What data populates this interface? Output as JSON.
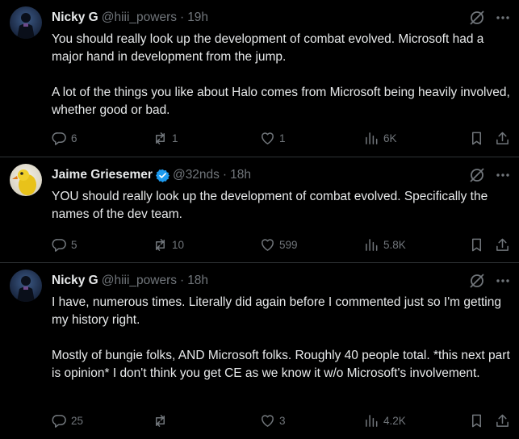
{
  "tweets": [
    {
      "author": {
        "name": "Nicky G",
        "handle": "@hiii_powers",
        "verified": false
      },
      "time": "19h",
      "paragraphs": [
        "You should really look up the development of combat evolved. Microsoft had a major hand in development from the jump.",
        "A lot of the things you like about Halo comes from Microsoft being heavily involved, whether good or bad."
      ],
      "stats": {
        "replies": "6",
        "retweets": "1",
        "likes": "1",
        "views": "6K"
      }
    },
    {
      "author": {
        "name": "Jaime Griesemer",
        "handle": "@32nds",
        "verified": true
      },
      "time": "18h",
      "paragraphs": [
        "YOU should really look up the development of combat evolved. Specifically the names of the dev team."
      ],
      "stats": {
        "replies": "5",
        "retweets": "10",
        "likes": "599",
        "views": "5.8K"
      }
    },
    {
      "author": {
        "name": "Nicky G",
        "handle": "@hiii_powers",
        "verified": false
      },
      "time": "18h",
      "paragraphs": [
        "I have, numerous times. Literally did again before I commented just so I'm getting my history right.",
        "Mostly of bungie folks, AND Microsoft folks. Roughly 40 people total. *this next part is opinion* I don't think you get CE as we know it w/o Microsoft's involvement."
      ],
      "stats": {
        "replies": "25",
        "retweets": "",
        "likes": "3",
        "views": "4.2K"
      }
    }
  ],
  "meta": {
    "dot": "·"
  },
  "colors": {
    "background": "#000000",
    "text": "#e7e9ea",
    "muted": "#71767b",
    "divider": "#2f3336",
    "verified": "#1d9bf0"
  }
}
